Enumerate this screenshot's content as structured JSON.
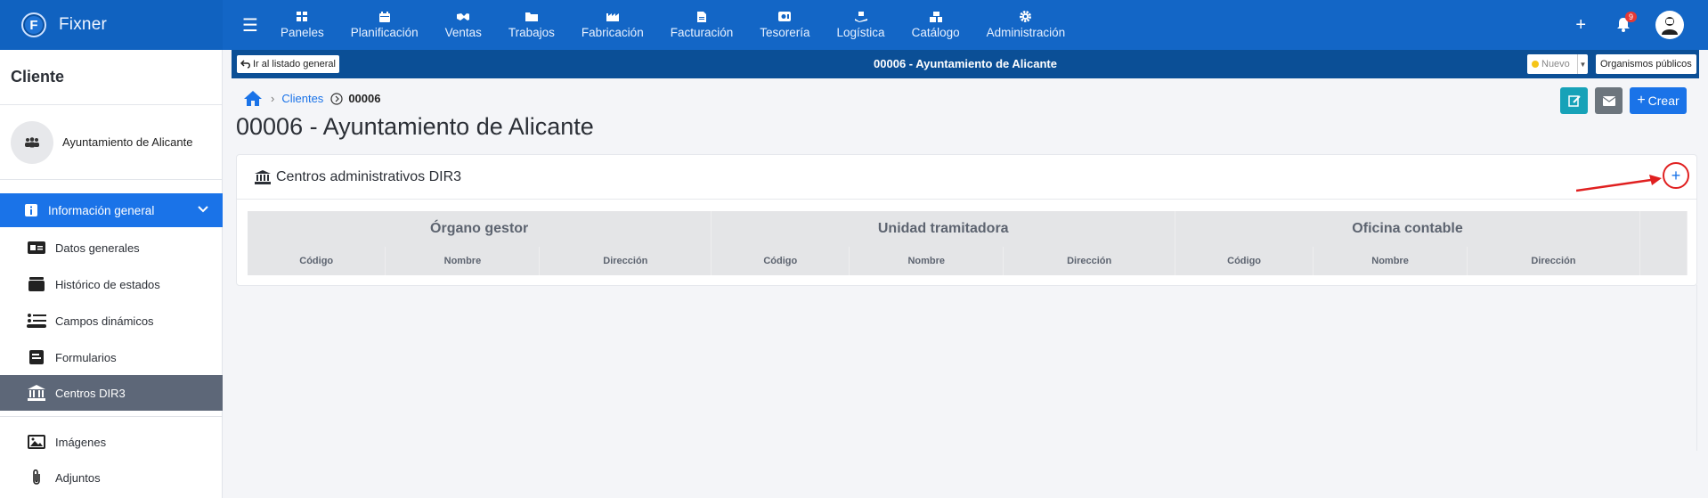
{
  "app": {
    "name": "Fixner"
  },
  "nav": {
    "items": [
      {
        "label": "Paneles",
        "icon": "dashboard-icon"
      },
      {
        "label": "Planificación",
        "icon": "calendar-icon"
      },
      {
        "label": "Ventas",
        "icon": "handshake-icon"
      },
      {
        "label": "Trabajos",
        "icon": "folder-icon"
      },
      {
        "label": "Fabricación",
        "icon": "factory-icon"
      },
      {
        "label": "Facturación",
        "icon": "invoice-icon"
      },
      {
        "label": "Tesorería",
        "icon": "cash-icon"
      },
      {
        "label": "Logística",
        "icon": "dolly-icon"
      },
      {
        "label": "Catálogo",
        "icon": "boxes-icon"
      },
      {
        "label": "Administración",
        "icon": "gear-icon"
      }
    ],
    "notifications_count": "9"
  },
  "sidebar": {
    "title": "Cliente",
    "client_name": "Ayuntamiento de Alicante",
    "section_label": "Información general",
    "items": [
      {
        "label": "Datos generales",
        "icon": "id-card-icon"
      },
      {
        "label": "Histórico de estados",
        "icon": "layers-icon"
      },
      {
        "label": "Campos dinámicos",
        "icon": "list-toggle-icon"
      },
      {
        "label": "Formularios",
        "icon": "form-icon"
      },
      {
        "label": "Centros DIR3",
        "icon": "institution-icon",
        "active": true
      },
      {
        "label": "Imágenes",
        "icon": "image-icon"
      },
      {
        "label": "Adjuntos",
        "icon": "paperclip-icon"
      }
    ]
  },
  "header_strip": {
    "back_label": "Ir al listado general",
    "title": "00006 - Ayuntamiento de Alicante",
    "status_value": "Nuevo",
    "org_button_label": "Organismos públicos"
  },
  "breadcrumb": {
    "clients_label": "Clientes",
    "current": "00006"
  },
  "page": {
    "title": "00006 - Ayuntamiento de Alicante",
    "create_label": "Crear"
  },
  "card": {
    "title": "Centros administrativos DIR3",
    "groups": [
      "Órgano gestor",
      "Unidad tramitadora",
      "Oficina contable"
    ],
    "columns": [
      "Código",
      "Nombre",
      "Dirección",
      "Código",
      "Nombre",
      "Dirección",
      "Código",
      "Nombre",
      "Dirección"
    ]
  },
  "colors": {
    "topbar": "#1366c6",
    "strip": "#0b4f96",
    "accent": "#1a73e8",
    "sidebar_active": "#5d6778",
    "highlight": "#e02020"
  }
}
